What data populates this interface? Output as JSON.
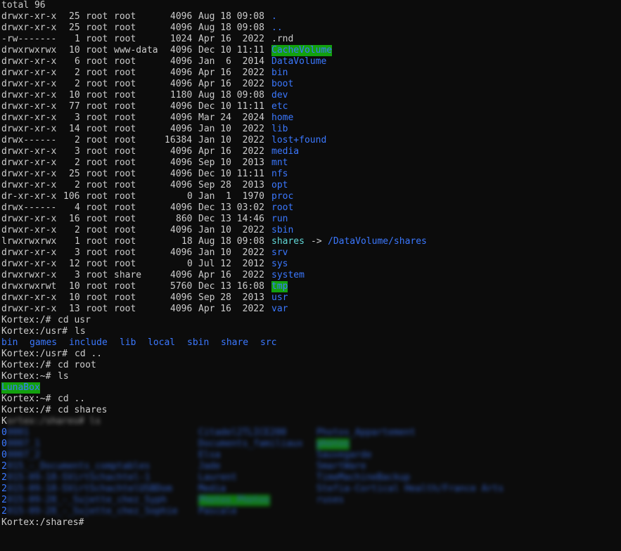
{
  "total": "total 96",
  "listing": [
    {
      "perm": "drwxr-xr-x",
      "links": "25",
      "owner": "root",
      "group": "root",
      "size": "4096",
      "date": "Aug 18 09:08",
      "name": ".",
      "type": "dir"
    },
    {
      "perm": "drwxr-xr-x",
      "links": "25",
      "owner": "root",
      "group": "root",
      "size": "4096",
      "date": "Aug 18 09:08",
      "name": "..",
      "type": "dir"
    },
    {
      "perm": "-rw-------",
      "links": "1",
      "owner": "root",
      "group": "root",
      "size": "1024",
      "date": "Apr 16  2022",
      "name": ".rnd",
      "type": "file"
    },
    {
      "perm": "drwxrwxrwx",
      "links": "10",
      "owner": "root",
      "group": "www-data",
      "size": "4096",
      "date": "Dec 10 11:11",
      "name": "CacheVolume",
      "type": "hl"
    },
    {
      "perm": "drwxr-xr-x",
      "links": "6",
      "owner": "root",
      "group": "root",
      "size": "4096",
      "date": "Jan  6  2014",
      "name": "DataVolume",
      "type": "dir"
    },
    {
      "perm": "drwxr-xr-x",
      "links": "2",
      "owner": "root",
      "group": "root",
      "size": "4096",
      "date": "Apr 16  2022",
      "name": "bin",
      "type": "dir"
    },
    {
      "perm": "drwxr-xr-x",
      "links": "2",
      "owner": "root",
      "group": "root",
      "size": "4096",
      "date": "Apr 16  2022",
      "name": "boot",
      "type": "dir"
    },
    {
      "perm": "drwxr-xr-x",
      "links": "10",
      "owner": "root",
      "group": "root",
      "size": "1180",
      "date": "Aug 18 09:08",
      "name": "dev",
      "type": "dir"
    },
    {
      "perm": "drwxr-xr-x",
      "links": "77",
      "owner": "root",
      "group": "root",
      "size": "4096",
      "date": "Dec 10 11:11",
      "name": "etc",
      "type": "dir"
    },
    {
      "perm": "drwxr-xr-x",
      "links": "3",
      "owner": "root",
      "group": "root",
      "size": "4096",
      "date": "Mar 24  2024",
      "name": "home",
      "type": "dir"
    },
    {
      "perm": "drwxr-xr-x",
      "links": "14",
      "owner": "root",
      "group": "root",
      "size": "4096",
      "date": "Jan 10  2022",
      "name": "lib",
      "type": "dir"
    },
    {
      "perm": "drwx------",
      "links": "2",
      "owner": "root",
      "group": "root",
      "size": "16384",
      "date": "Jan 10  2022",
      "name": "lost+found",
      "type": "dir"
    },
    {
      "perm": "drwxr-xr-x",
      "links": "3",
      "owner": "root",
      "group": "root",
      "size": "4096",
      "date": "Apr 16  2022",
      "name": "media",
      "type": "dir"
    },
    {
      "perm": "drwxr-xr-x",
      "links": "2",
      "owner": "root",
      "group": "root",
      "size": "4096",
      "date": "Sep 10  2013",
      "name": "mnt",
      "type": "dir"
    },
    {
      "perm": "drwxr-xr-x",
      "links": "25",
      "owner": "root",
      "group": "root",
      "size": "4096",
      "date": "Dec 10 11:11",
      "name": "nfs",
      "type": "dir"
    },
    {
      "perm": "drwxr-xr-x",
      "links": "2",
      "owner": "root",
      "group": "root",
      "size": "4096",
      "date": "Sep 28  2013",
      "name": "opt",
      "type": "dir"
    },
    {
      "perm": "dr-xr-xr-x",
      "links": "106",
      "owner": "root",
      "group": "root",
      "size": "0",
      "date": "Jan  1  1970",
      "name": "proc",
      "type": "dir"
    },
    {
      "perm": "drwx------",
      "links": "4",
      "owner": "root",
      "group": "root",
      "size": "4096",
      "date": "Dec 13 03:02",
      "name": "root",
      "type": "dir"
    },
    {
      "perm": "drwxr-xr-x",
      "links": "16",
      "owner": "root",
      "group": "root",
      "size": "860",
      "date": "Dec 13 14:46",
      "name": "run",
      "type": "dir"
    },
    {
      "perm": "drwxr-xr-x",
      "links": "2",
      "owner": "root",
      "group": "root",
      "size": "4096",
      "date": "Jan 10  2022",
      "name": "sbin",
      "type": "dir"
    },
    {
      "perm": "lrwxrwxrwx",
      "links": "1",
      "owner": "root",
      "group": "root",
      "size": "18",
      "date": "Aug 18 09:08",
      "name": "shares",
      "type": "lnk",
      "arrow": "->",
      "target": "/DataVolume/shares"
    },
    {
      "perm": "drwxr-xr-x",
      "links": "3",
      "owner": "root",
      "group": "root",
      "size": "4096",
      "date": "Jan 10  2022",
      "name": "srv",
      "type": "dir"
    },
    {
      "perm": "drwxr-xr-x",
      "links": "12",
      "owner": "root",
      "group": "root",
      "size": "0",
      "date": "Jul 12  2012",
      "name": "sys",
      "type": "dir"
    },
    {
      "perm": "drwxrwxr-x",
      "links": "3",
      "owner": "root",
      "group": "share",
      "size": "4096",
      "date": "Apr 16  2022",
      "name": "system",
      "type": "dir"
    },
    {
      "perm": "drwxrwxrwt",
      "links": "10",
      "owner": "root",
      "group": "root",
      "size": "5760",
      "date": "Dec 13 16:08",
      "name": "tmp",
      "type": "hl"
    },
    {
      "perm": "drwxr-xr-x",
      "links": "10",
      "owner": "root",
      "group": "root",
      "size": "4096",
      "date": "Sep 28  2013",
      "name": "usr",
      "type": "dir"
    },
    {
      "perm": "drwxr-xr-x",
      "links": "13",
      "owner": "root",
      "group": "root",
      "size": "4096",
      "date": "Apr 16  2022",
      "name": "var",
      "type": "dir"
    }
  ],
  "session": [
    {
      "prompt": "Kortex:/# ",
      "cmd": "cd usr"
    },
    {
      "prompt": "Kortex:/usr# ",
      "cmd": "ls"
    },
    {
      "usr_items": [
        "bin",
        "games",
        "include",
        "lib",
        "local",
        "sbin",
        "share",
        "src"
      ]
    },
    {
      "prompt": "Kortex:/usr# ",
      "cmd": "cd .."
    },
    {
      "prompt": "Kortex:/# ",
      "cmd": "cd root"
    },
    {
      "prompt": "Kortex:~# ",
      "cmd": "ls"
    },
    {
      "root_items": [
        "LunaBox"
      ]
    },
    {
      "prompt": "Kortex:~# ",
      "cmd": "cd .."
    },
    {
      "prompt": "Kortex:/# ",
      "cmd": "cd shares"
    }
  ],
  "shares_blurred": {
    "prompt_first_char": "K",
    "prompt_rest": "ortex:/shares# ls",
    "rows": [
      [
        "0",
        "0001",
        "Citadel2TLICE200",
        "Photos_Appartement"
      ],
      [
        "0",
        "0007_1",
        "Documents_familiaux",
        "photos"
      ],
      [
        "0",
        "0007_2",
        "Elsa",
        "Sauvegarde"
      ],
      [
        "2",
        "015_-_Documents_comptables",
        "Jade",
        "SmartWare"
      ],
      [
        "2",
        "015-09-18-SVirtSchachtel-1",
        "Laurent",
        "TimeMachineBackup"
      ],
      [
        "2",
        "015-09-18-SVirtSchachtelUSBDom",
        "Media",
        "Stefia-Cortical Health/France Arts"
      ],
      [
        "2",
        "015-09-28_-_Sujette_chez_Syph",
        "Photos_Photos",
        "ruses"
      ],
      [
        "2",
        "015-09-28_-_Sujette_chez_Sophie",
        "Pascale",
        ""
      ]
    ]
  },
  "final_prompt": "Kortex:/shares# ",
  "colors": {
    "background": "#0c0c0c",
    "text": "#cccccc",
    "directory": "#3b78ff",
    "symlink": "#61d6d6",
    "highlight_bg": "#13a10e"
  }
}
